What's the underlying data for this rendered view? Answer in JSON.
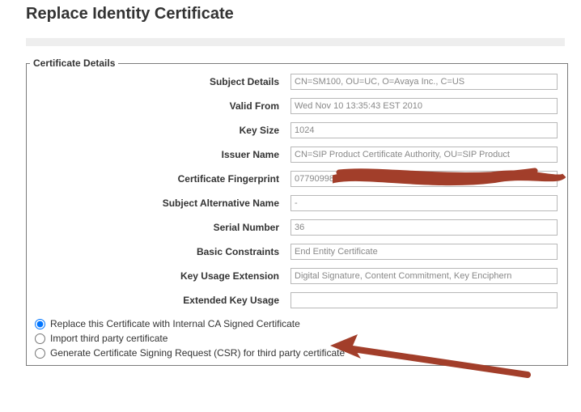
{
  "page": {
    "title": "Replace Identity Certificate"
  },
  "fieldset": {
    "legend": "Certificate Details"
  },
  "cert": {
    "subject_details": {
      "label": "Subject Details",
      "value": "CN=SM100, OU=UC, O=Avaya Inc., C=US"
    },
    "valid_from": {
      "label": "Valid From",
      "value": "Wed Nov 10 13:35:43 EST 2010"
    },
    "key_size": {
      "label": "Key Size",
      "value": "1024"
    },
    "issuer_name": {
      "label": "Issuer Name",
      "value": "CN=SIP Product Certificate Authority, OU=SIP Product"
    },
    "fingerprint": {
      "label": "Certificate Fingerprint",
      "value": "07790998"
    },
    "san": {
      "label": "Subject Alternative Name",
      "value": "-"
    },
    "serial": {
      "label": "Serial Number",
      "value": "36"
    },
    "basic": {
      "label": "Basic Constraints",
      "value": "End Entity Certificate"
    },
    "key_usage": {
      "label": "Key Usage Extension",
      "value": "Digital Signature, Content Commitment, Key Enciphern"
    },
    "ext_key_usage": {
      "label": "Extended Key Usage",
      "value": ""
    }
  },
  "options": {
    "replace_internal": "Replace this Certificate with Internal CA Signed Certificate",
    "import_third": "Import third party certificate",
    "gen_csr": "Generate Certificate Signing Request (CSR) for third party certificate"
  },
  "annotations": {
    "redaction_color": "#a23e2a",
    "arrow_color": "#a23e2a"
  }
}
